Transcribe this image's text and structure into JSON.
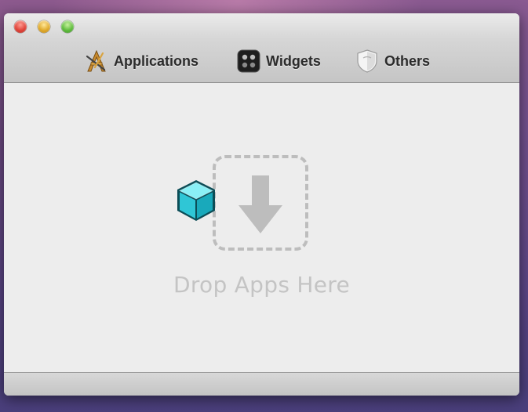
{
  "toolbar": {
    "items": [
      {
        "label": "Applications",
        "icon": "applications-icon"
      },
      {
        "label": "Widgets",
        "icon": "widgets-icon"
      },
      {
        "label": "Others",
        "icon": "others-icon"
      }
    ]
  },
  "drop_zone": {
    "label": "Drop Apps Here",
    "icon": "download-arrow-icon"
  },
  "dragged_item": {
    "icon": "app-cube-icon"
  },
  "colors": {
    "traffic_close": "#e0443a",
    "traffic_minimize": "#e0aa2c",
    "traffic_zoom": "#5fbc3d",
    "cube": "#3fd3e0",
    "drop_hint": "#c4c4c4"
  }
}
